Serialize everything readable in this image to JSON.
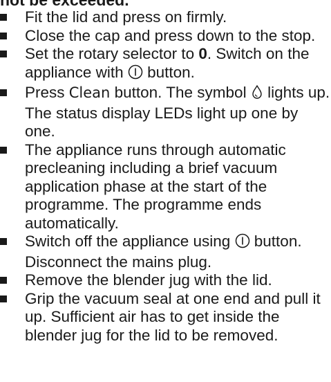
{
  "fragment": {
    "text": "not be exceeded."
  },
  "steps": [
    {
      "text": "Fit the lid and press on firmly."
    },
    {
      "text": "Close the cap and press down to the stop."
    },
    {
      "prefix": "Set the rotary selector to ",
      "bold_value": "0",
      "middle": ". Switch on the appliance with ",
      "icon": "power-button-icon",
      "suffix": " button."
    },
    {
      "prefix": "Press ",
      "button_label": "Clean",
      "middle": " button. The symbol ",
      "icon": "cleaning-drop-icon",
      "suffix": " lights up. The status display LEDs light up one by one."
    },
    {
      "text": "The appliance runs through automatic precleaning including a brief vacuum application phase at the start of the programme. The programme ends automatically."
    },
    {
      "prefix": "Switch off the appliance using ",
      "icon": "power-button-icon",
      "suffix": " button. Disconnect the mains plug."
    },
    {
      "text": "Remove the blender jug with the lid."
    },
    {
      "text": "Grip the vacuum seal at one end and pull it up. Sufficient air has to get inside the blender jug for the lid to be removed."
    }
  ]
}
